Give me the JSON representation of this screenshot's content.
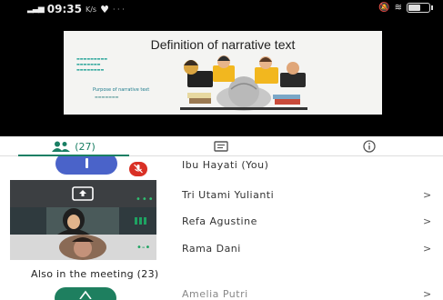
{
  "status_bar": {
    "time": "09:35",
    "speed": "K/s",
    "dots": "· · ·"
  },
  "slide": {
    "title": "Definition of narrative text",
    "caption": "Purpose of narrative text"
  },
  "tabs": {
    "people_count": "(27)"
  },
  "participants": [
    {
      "name": "Ibu Hayati (You)",
      "muted": true
    },
    {
      "name": "Tri Utami Yulianti",
      "chevron": ">"
    },
    {
      "name": "Refa Agustine",
      "chevron": ">"
    },
    {
      "name": "Rama Dani",
      "chevron": ">"
    }
  ],
  "also_in_meeting": {
    "heading": "Also in the meeting (23)",
    "first": {
      "name": "Amelia Putri",
      "chevron": ">"
    }
  },
  "colors": {
    "accent": "#1a7f64",
    "avatar_blue": "#4a63c9",
    "mute_red": "#d93025",
    "audio_green": "#1ea362"
  },
  "battery_level": 0.6
}
